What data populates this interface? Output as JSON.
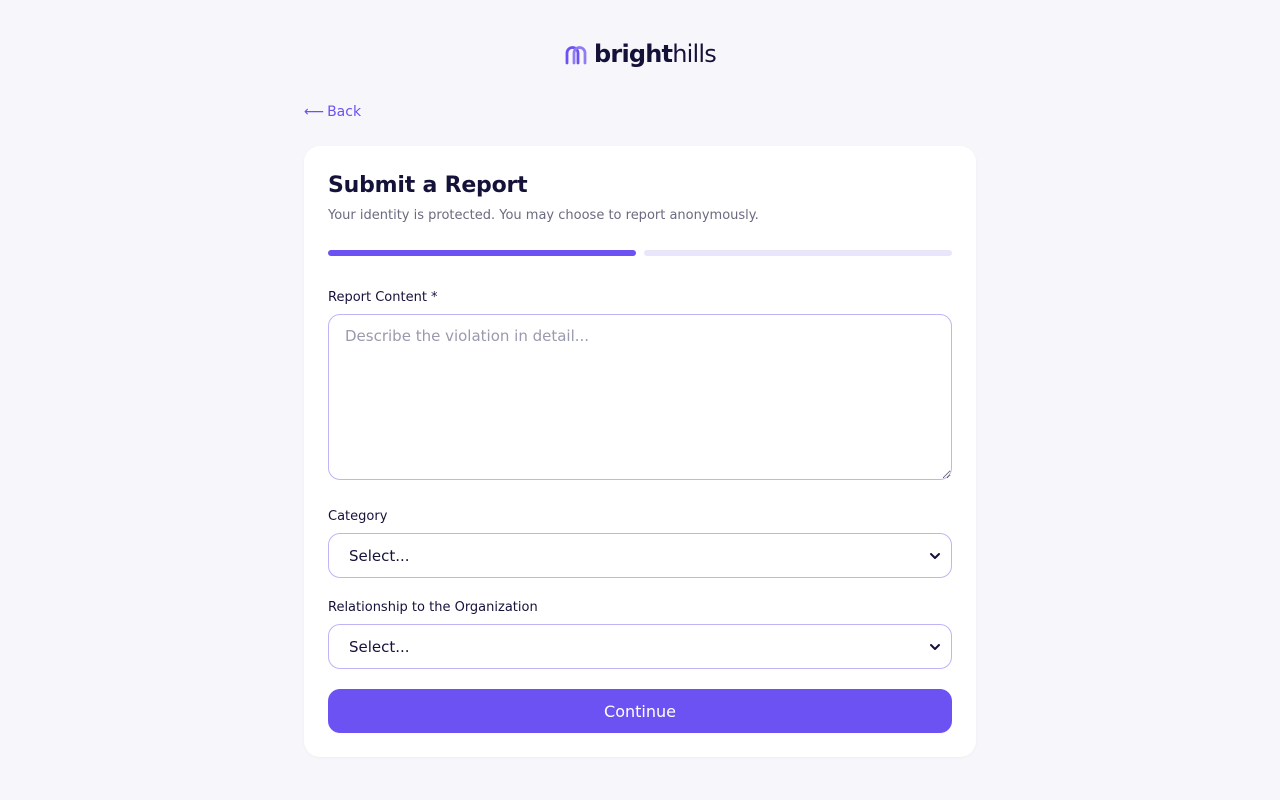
{
  "brand": {
    "name_bold": "bright",
    "name_light": "hills",
    "logo_icon": "arch-logo-icon",
    "accent_color": "#6c52f2"
  },
  "nav": {
    "back_arrow": "⟵",
    "back_label": "Back"
  },
  "form": {
    "title": "Submit a Report",
    "subtitle": "Your identity is protected. You may choose to report anonymously.",
    "progress": {
      "total_steps": 2,
      "current_step": 1
    },
    "report_content": {
      "label": "Report Content *",
      "placeholder": "Describe the violation in detail...",
      "value": ""
    },
    "category": {
      "label": "Category",
      "selected": "Select..."
    },
    "relationship": {
      "label": "Relationship to the Organization",
      "selected": "Select..."
    },
    "continue_label": "Continue"
  }
}
